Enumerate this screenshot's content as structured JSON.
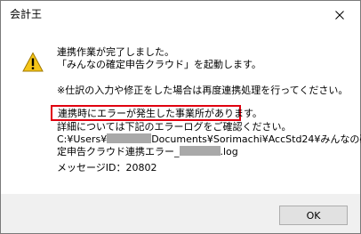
{
  "window": {
    "title": "会計王"
  },
  "dialog": {
    "line1": "連携作業が完了しました。",
    "line2": "「みんなの確定申告クラウド」を起動します。",
    "line3": "※仕訳の入力や修正をした場合は再度連携処理を行ってください。",
    "highlighted_line": "連携時にエラーが発生した事業所があります。",
    "line5": "詳細については下記のエラーログをご確認ください。",
    "path_part1": "C:¥Users¥",
    "path_part2": "Documents¥Sorimachi¥AccStd24¥みんなの確",
    "path_part3": "定申告クラウド連携エラー_",
    "path_part4": ".log",
    "message_id": "メッセージID：20802"
  },
  "buttons": {
    "ok": "OK"
  },
  "colors": {
    "highlight_border": "#e0000f",
    "warning_fill": "#f5c518",
    "redaction": "#a9a9a9"
  },
  "icons": {
    "warning": "warning-triangle-icon",
    "close": "close-icon"
  }
}
